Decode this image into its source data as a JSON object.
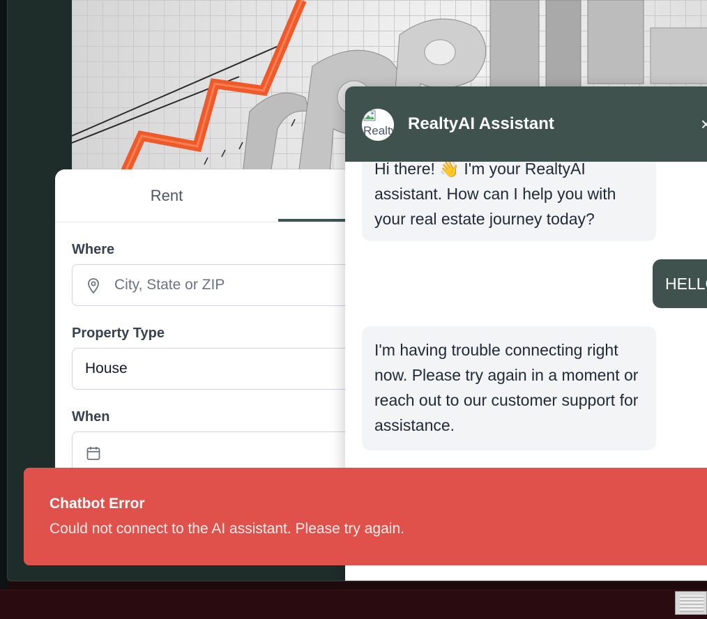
{
  "search": {
    "tabs": [
      {
        "label": "Rent"
      }
    ],
    "where": {
      "label": "Where",
      "placeholder": "City, State or ZIP"
    },
    "property_type": {
      "label": "Property Type",
      "value": "House"
    },
    "when": {
      "label": "When"
    }
  },
  "chat": {
    "title": "RealtyAI Assistant",
    "avatar_alt": "Realty",
    "close_symbol": "×",
    "messages": [
      {
        "role": "assistant",
        "text": "Hi there! 👋 I'm your RealtyAI assistant. How can I help you with your real estate journey today?"
      },
      {
        "role": "user",
        "text": "HELLO"
      },
      {
        "role": "assistant",
        "text": "I'm having trouble connecting right now. Please try again in a moment or reach out to our customer support for assistance."
      }
    ]
  },
  "toast": {
    "title": "Chatbot Error",
    "message": "Could not connect to the AI assistant. Please try again."
  },
  "colors": {
    "brand": "#3f524e",
    "error": "#e1514c",
    "app_background": "#1e2c2a"
  }
}
